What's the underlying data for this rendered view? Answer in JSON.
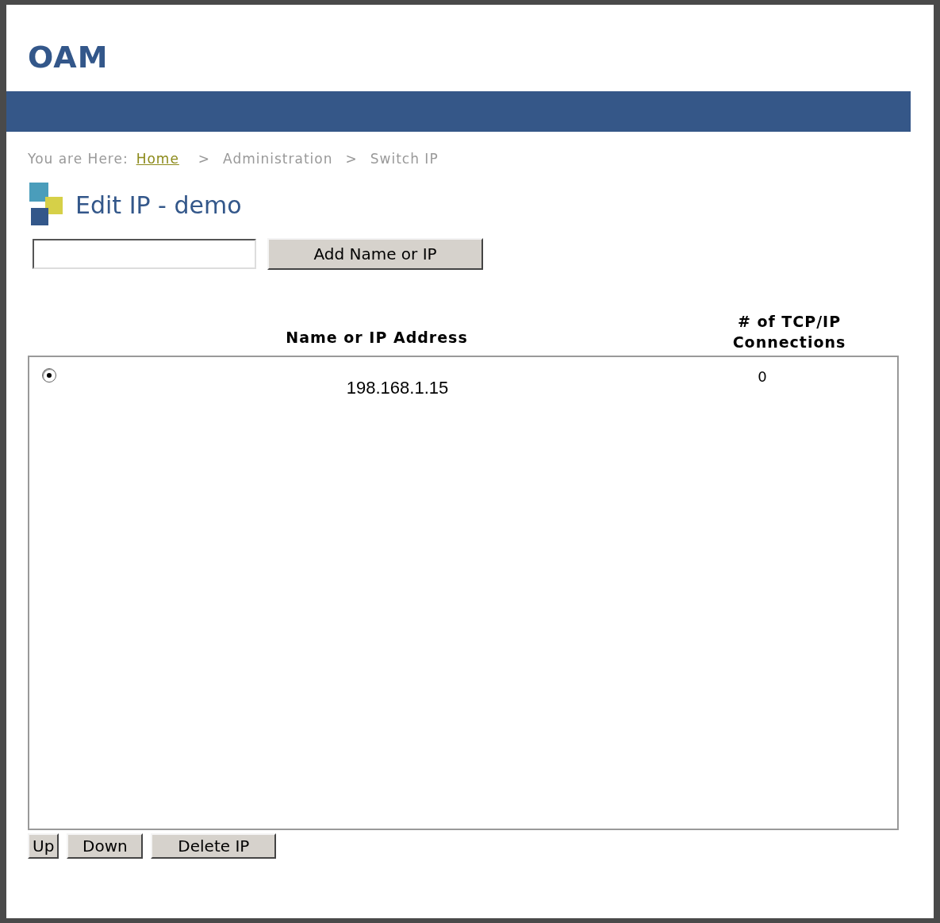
{
  "header": {
    "title": "OAM"
  },
  "breadcrumb": {
    "prefix": "You are Here:",
    "separator": ">",
    "items": [
      {
        "label": "Home",
        "kind": "link"
      },
      {
        "label": "Administration",
        "kind": "text"
      },
      {
        "label": "Switch IP",
        "kind": "text"
      }
    ]
  },
  "page_title": "Edit IP - demo",
  "add_form": {
    "button": "Add Name or IP"
  },
  "table": {
    "columns": [
      "Name or IP Address",
      "# of TCP/IP Connections"
    ],
    "rows": [
      {
        "selected": true,
        "name": "198.168.1.15",
        "connections": "0"
      }
    ]
  },
  "buttons": [
    "Up",
    "Down",
    "Delete IP"
  ]
}
